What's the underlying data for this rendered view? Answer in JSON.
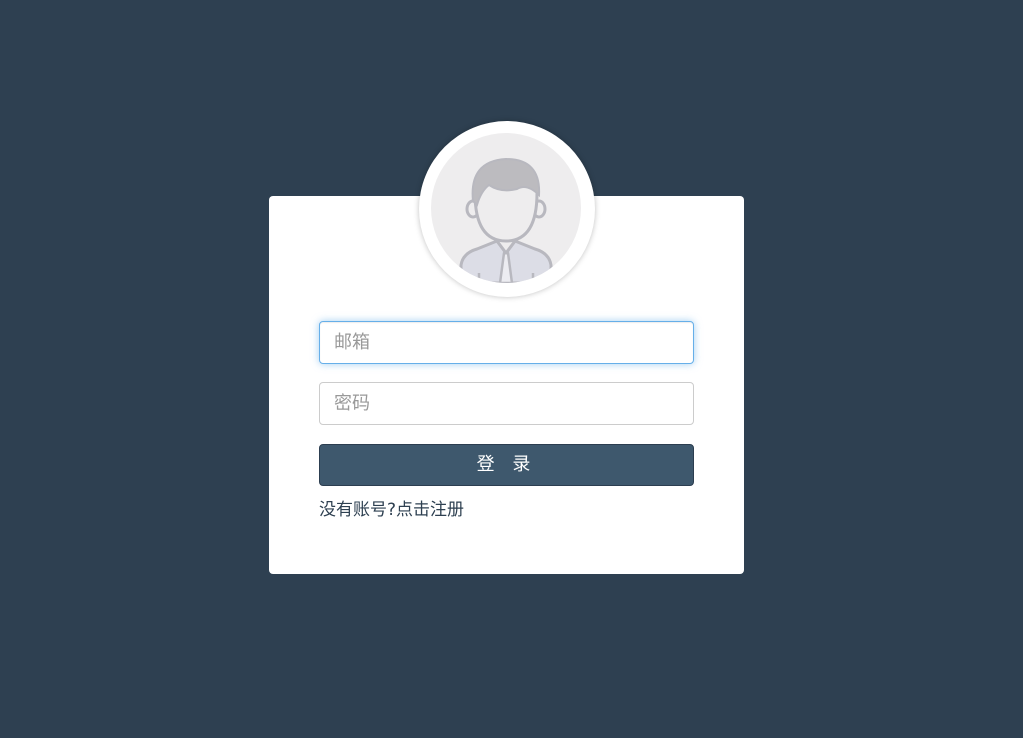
{
  "login_form": {
    "email": {
      "value": "",
      "placeholder": "邮箱"
    },
    "password": {
      "value": "",
      "placeholder": "密码"
    },
    "login_button_label": "登 录",
    "register_prompt": "没有账号?",
    "register_link_label": "点击注册"
  },
  "avatar": {
    "icon": "user-avatar-icon"
  },
  "colors": {
    "background": "#2e4051",
    "card": "#ffffff",
    "button": "#3e586d",
    "focus_border": "#66afe9"
  }
}
